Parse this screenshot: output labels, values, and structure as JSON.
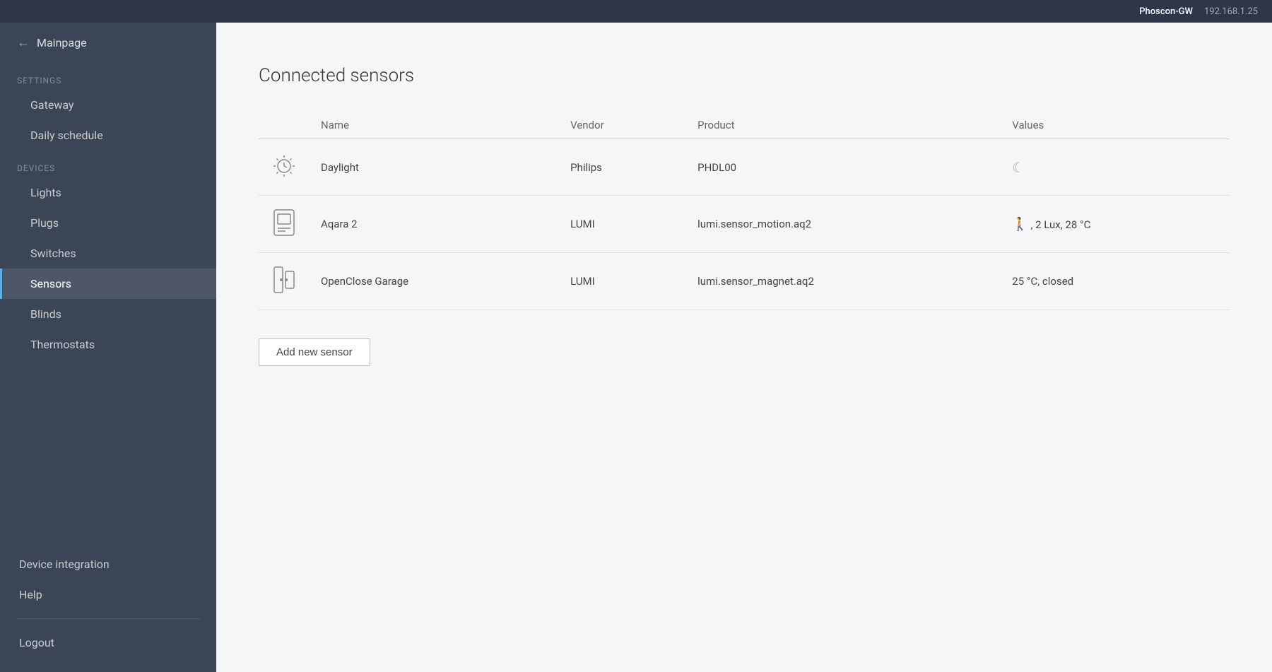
{
  "topbar": {
    "gateway_name": "Phoscon-GW",
    "ip_address": "192.168.1.25"
  },
  "sidebar": {
    "mainpage_label": "Mainpage",
    "settings_label": "Settings",
    "settings_items": [
      {
        "id": "gateway",
        "label": "Gateway"
      },
      {
        "id": "daily-schedule",
        "label": "Daily schedule"
      }
    ],
    "devices_label": "Devices",
    "devices_items": [
      {
        "id": "lights",
        "label": "Lights"
      },
      {
        "id": "plugs",
        "label": "Plugs"
      },
      {
        "id": "switches",
        "label": "Switches"
      },
      {
        "id": "sensors",
        "label": "Sensors",
        "active": true
      },
      {
        "id": "blinds",
        "label": "Blinds"
      },
      {
        "id": "thermostats",
        "label": "Thermostats"
      }
    ],
    "device_integration_label": "Device integration",
    "help_label": "Help",
    "logout_label": "Logout"
  },
  "main": {
    "title": "Connected sensors",
    "table": {
      "columns": [
        "",
        "Name",
        "Vendor",
        "Product",
        "Values"
      ],
      "rows": [
        {
          "icon": "sun-clock",
          "name": "Daylight",
          "vendor": "Philips",
          "product": "PHDL00",
          "values": "☽"
        },
        {
          "icon": "motion-sensor",
          "name": "Aqara 2",
          "vendor": "LUMI",
          "product": "lumi.sensor_motion.aq2",
          "values": "🚶 , 2 Lux, 28 °C"
        },
        {
          "icon": "door-sensor",
          "name": "OpenClose Garage",
          "vendor": "LUMI",
          "product": "lumi.sensor_magnet.aq2",
          "values": "25 °C, closed"
        }
      ]
    },
    "add_button_label": "Add new sensor"
  }
}
